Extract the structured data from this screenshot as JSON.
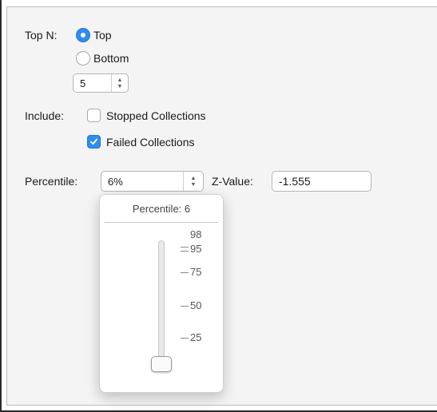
{
  "top_n": {
    "label": "Top N:",
    "options": [
      {
        "label": "Top",
        "selected": true
      },
      {
        "label": "Bottom",
        "selected": false
      }
    ],
    "count": "5"
  },
  "include": {
    "label": "Include:",
    "options": [
      {
        "label": "Stopped Collections",
        "checked": false
      },
      {
        "label": "Failed Collections",
        "checked": true
      }
    ]
  },
  "percentile": {
    "label": "Percentile:",
    "value": "6%"
  },
  "zvalue": {
    "label": "Z-Value:",
    "value": "-1.555"
  },
  "popover": {
    "title": "Percentile: 6",
    "slider_value": 6,
    "tick_labels": [
      "98",
      "95",
      "75",
      "50",
      "25"
    ]
  },
  "colors": {
    "accent": "#2f8cf0"
  }
}
